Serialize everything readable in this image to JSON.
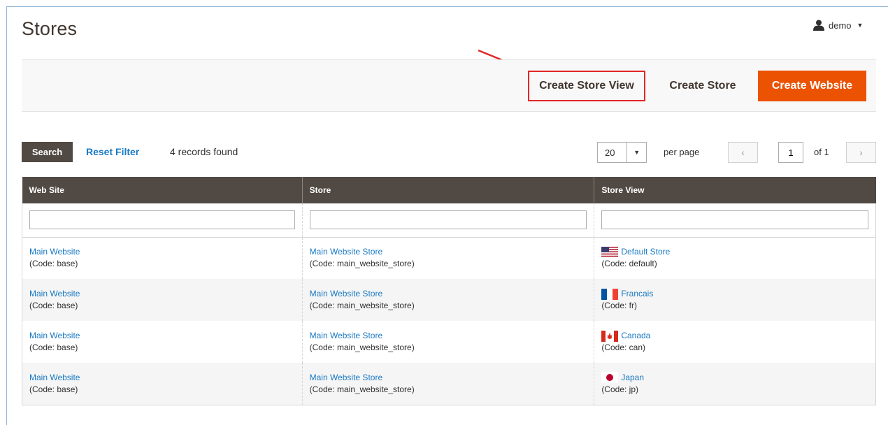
{
  "header": {
    "title": "Stores",
    "user": "demo",
    "user_icon": "user-icon"
  },
  "actions": {
    "create_store_view": "Create Store View",
    "create_store": "Create Store",
    "create_website": "Create Website"
  },
  "colors": {
    "brand_dark": "#514943",
    "accent": "#eb5202",
    "link": "#1979c3",
    "highlight": "#e22626"
  },
  "toolbar": {
    "search_label": "Search",
    "reset_label": "Reset Filter",
    "records": "4 records found",
    "per_page_value": "20",
    "per_page_label": "per page",
    "page_value": "1",
    "page_of": "of 1"
  },
  "grid": {
    "columns": [
      "Web Site",
      "Store",
      "Store View"
    ],
    "rows": [
      {
        "website": "Main Website",
        "website_code": "(Code: base)",
        "store": "Main Website Store",
        "store_code": "(Code: main_website_store)",
        "view": "Default Store",
        "view_code": "(Code: default)",
        "flag": "us-flag-icon"
      },
      {
        "website": "Main Website",
        "website_code": "(Code: base)",
        "store": "Main Website Store",
        "store_code": "(Code: main_website_store)",
        "view": "Francais",
        "view_code": "(Code: fr)",
        "flag": "fr-flag-icon"
      },
      {
        "website": "Main Website",
        "website_code": "(Code: base)",
        "store": "Main Website Store",
        "store_code": "(Code: main_website_store)",
        "view": "Canada",
        "view_code": "(Code: can)",
        "flag": "ca-flag-icon"
      },
      {
        "website": "Main Website",
        "website_code": "(Code: base)",
        "store": "Main Website Store",
        "store_code": "(Code: main_website_store)",
        "view": "Japan",
        "view_code": "(Code: jp)",
        "flag": "jp-flag-icon"
      }
    ]
  }
}
